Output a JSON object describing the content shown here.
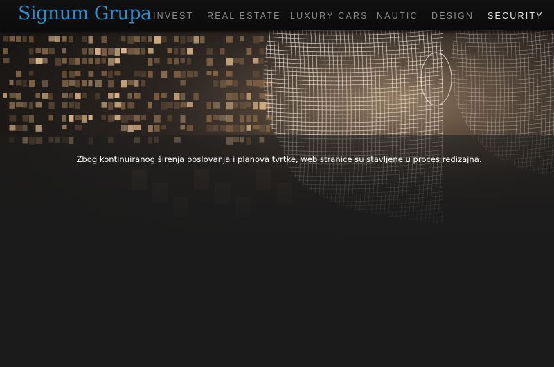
{
  "header": {
    "logo_text": "Signum Grupa",
    "logo_color": "#2e8fd0"
  },
  "nav": {
    "items": [
      {
        "label": "INVEST",
        "active": false
      },
      {
        "label": "REAL ESTATE",
        "active": false
      },
      {
        "label": "LUXURY CARS",
        "active": false
      },
      {
        "label": "NAUTIC",
        "active": false
      },
      {
        "label": "DESIGN",
        "active": false
      },
      {
        "label": "SECURITY",
        "active": true
      }
    ]
  },
  "hero": {
    "image": "wireframe-face-security-graphic"
  },
  "content": {
    "message": "Zbog kontinuiranog širenja poslovanja i planova tvrtke, web stranice su stavljene u proces redizajna."
  }
}
